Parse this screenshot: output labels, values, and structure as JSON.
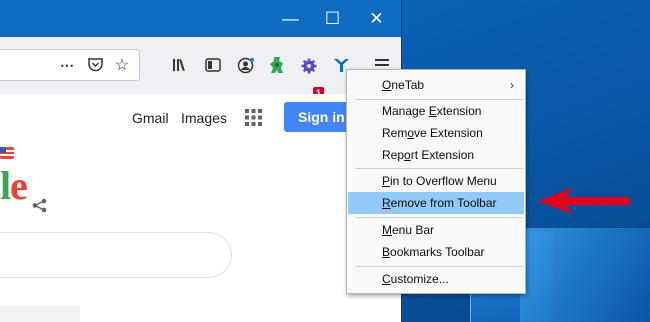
{
  "window": {
    "controls": [
      "—",
      "☐",
      "✕"
    ]
  },
  "page": {
    "links": [
      "Gmail",
      "Images"
    ],
    "signin": "Sign in",
    "logo_letters": [
      "l",
      "e"
    ]
  },
  "toolbar": {
    "badge_count": "1",
    "more_icon": "⋯"
  },
  "menu": {
    "items": [
      {
        "pre": "",
        "u": "O",
        "post": "neTab",
        "submenu": true
      },
      {
        "pre": "Manage ",
        "u": "E",
        "post": "xtension"
      },
      {
        "pre": "Rem",
        "u": "o",
        "post": "ve Extension"
      },
      {
        "pre": "Rep",
        "u": "o",
        "post": "rt Extension"
      },
      {
        "pre": "",
        "u": "P",
        "post": "in to Overflow Menu"
      },
      {
        "pre": "",
        "u": "R",
        "post": "emove from Toolbar",
        "highlighted": true
      },
      {
        "pre": "",
        "u": "M",
        "post": "enu Bar"
      },
      {
        "pre": "",
        "u": "B",
        "post": "ookmarks Toolbar"
      },
      {
        "pre": "",
        "u": "C",
        "post": "ustomize..."
      }
    ]
  },
  "colors": {
    "arrow": "#e2001a",
    "highlight": "#91c9f7",
    "titlebar": "#0f6cc2",
    "signin": "#4285f4"
  }
}
